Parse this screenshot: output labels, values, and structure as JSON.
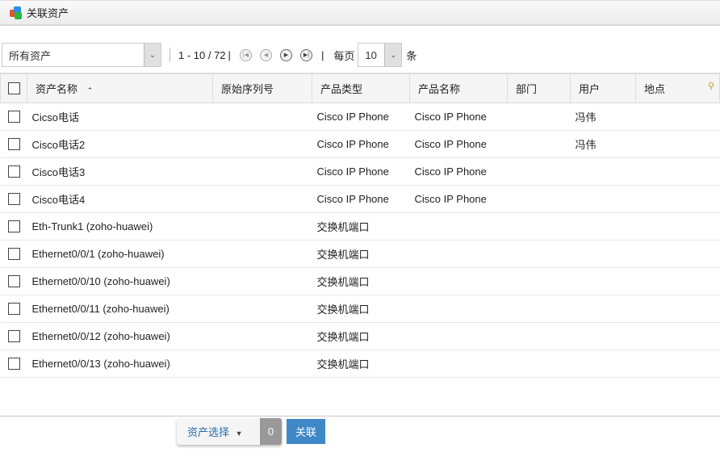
{
  "title": "关联资产",
  "toolbar": {
    "filter": "所有资产",
    "range": "1 - 10 / 72",
    "per_page_label": "每页",
    "per_page": "10",
    "unit": "条"
  },
  "columns": [
    "资产名称",
    "原始序列号",
    "产品类型",
    "产品名称",
    "部门",
    "用户",
    "地点"
  ],
  "rows": [
    {
      "name": "Cicso电话",
      "serial": "",
      "type": "Cisco IP Phone",
      "product": "Cisco IP Phone",
      "dept": "",
      "user": "冯伟",
      "location": ""
    },
    {
      "name": "Cisco电话2",
      "serial": "",
      "type": "Cisco IP Phone",
      "product": "Cisco IP Phone",
      "dept": "",
      "user": "冯伟",
      "location": ""
    },
    {
      "name": "Cisco电话3",
      "serial": "",
      "type": "Cisco IP Phone",
      "product": "Cisco IP Phone",
      "dept": "",
      "user": "",
      "location": ""
    },
    {
      "name": "Cisco电话4",
      "serial": "",
      "type": "Cisco IP Phone",
      "product": "Cisco IP Phone",
      "dept": "",
      "user": "",
      "location": ""
    },
    {
      "name": "Eth-Trunk1 (zoho-huawei)",
      "serial": "",
      "type": "交换机端口",
      "product": "",
      "dept": "",
      "user": "",
      "location": ""
    },
    {
      "name": "Ethernet0/0/1 (zoho-huawei)",
      "serial": "",
      "type": "交换机端口",
      "product": "",
      "dept": "",
      "user": "",
      "location": ""
    },
    {
      "name": "Ethernet0/0/10 (zoho-huawei)",
      "serial": "",
      "type": "交换机端口",
      "product": "",
      "dept": "",
      "user": "",
      "location": ""
    },
    {
      "name": "Ethernet0/0/11 (zoho-huawei)",
      "serial": "",
      "type": "交换机端口",
      "product": "",
      "dept": "",
      "user": "",
      "location": ""
    },
    {
      "name": "Ethernet0/0/12 (zoho-huawei)",
      "serial": "",
      "type": "交换机端口",
      "product": "",
      "dept": "",
      "user": "",
      "location": ""
    },
    {
      "name": "Ethernet0/0/13 (zoho-huawei)",
      "serial": "",
      "type": "交换机端口",
      "product": "",
      "dept": "",
      "user": "",
      "location": ""
    }
  ],
  "footer": {
    "asset_select": "资产选择",
    "count": "0",
    "link": "关联"
  }
}
